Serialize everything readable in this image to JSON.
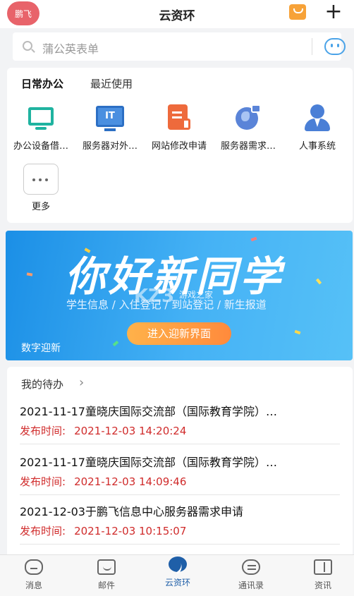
{
  "header": {
    "avatar_text": "鹏飞",
    "title": "云资环",
    "add_symbol": "+"
  },
  "search": {
    "placeholder": "蒲公英表单"
  },
  "office": {
    "tabs": [
      {
        "label": "日常办公"
      },
      {
        "label": "最近使用"
      }
    ],
    "apps": [
      {
        "label": "办公设备借…",
        "icon": "monitor-icon"
      },
      {
        "label": "服务器对外…",
        "icon": "it-server-icon"
      },
      {
        "label": "网站修改申请",
        "icon": "document-edit-icon"
      },
      {
        "label": "服务器需求…",
        "icon": "globe-lock-icon"
      },
      {
        "label": "人事系统",
        "icon": "person-icon"
      }
    ],
    "more": {
      "label": "更多",
      "icon": "more-dots-icon"
    }
  },
  "banner": {
    "headline": "你好新同学",
    "subtitle": "学生信息 / 入住登记 / 到站登记 / 新生报道",
    "cta": "进入迎新界面",
    "tag": "数字迎新",
    "watermark": "KZ3",
    "watermark_sub": "游戏之家"
  },
  "todo": {
    "title": "我的待办",
    "chevron": "›",
    "date_label": "发布时间:",
    "items": [
      {
        "title": "2021-11-17童晓庆国际交流部（国际教育学院）…",
        "time": "2021-12-03 14:20:24"
      },
      {
        "title": "2021-11-17童晓庆国际交流部（国际教育学院）…",
        "time": "2021-12-03 14:09:46"
      },
      {
        "title": "2021-12-03于鹏飞信息中心服务器需求申请",
        "time": "2021-12-03 10:15:07"
      }
    ]
  },
  "tabbar": {
    "items": [
      {
        "label": "消息",
        "icon": "message-icon"
      },
      {
        "label": "邮件",
        "icon": "mail-icon"
      },
      {
        "label": "云资环",
        "icon": "cloud-home-icon",
        "active": true
      },
      {
        "label": "通讯录",
        "icon": "contacts-icon"
      },
      {
        "label": "资讯",
        "icon": "news-icon"
      }
    ]
  },
  "colors": {
    "accent": "#1f5fa8",
    "banner": "#1b8fe6",
    "date_text": "#d02b2b",
    "avatar": "#e8636a"
  }
}
